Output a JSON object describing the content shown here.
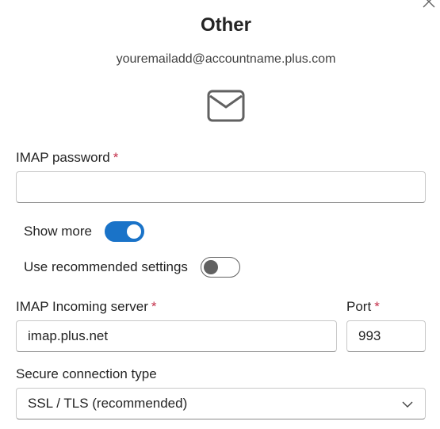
{
  "title": "Other",
  "email": "youremailadd@accountname.plus.com",
  "fields": {
    "password": {
      "label": "IMAP password",
      "required_mark": "*",
      "value": ""
    },
    "show_more": {
      "label": "Show more",
      "on": true
    },
    "recommended": {
      "label": "Use recommended settings",
      "on": false
    },
    "incoming_server": {
      "label": "IMAP Incoming server",
      "required_mark": "*",
      "value": "imap.plus.net"
    },
    "port": {
      "label": "Port",
      "required_mark": "*",
      "value": "993"
    },
    "secure_connection": {
      "label": "Secure connection type",
      "value": "SSL / TLS (recommended)"
    }
  },
  "colors": {
    "accent": "#1a73c8",
    "required": "#c4314b"
  },
  "icons": {
    "close": "close-icon",
    "mail": "mail-icon",
    "dropdown": "chevron-down-icon"
  }
}
